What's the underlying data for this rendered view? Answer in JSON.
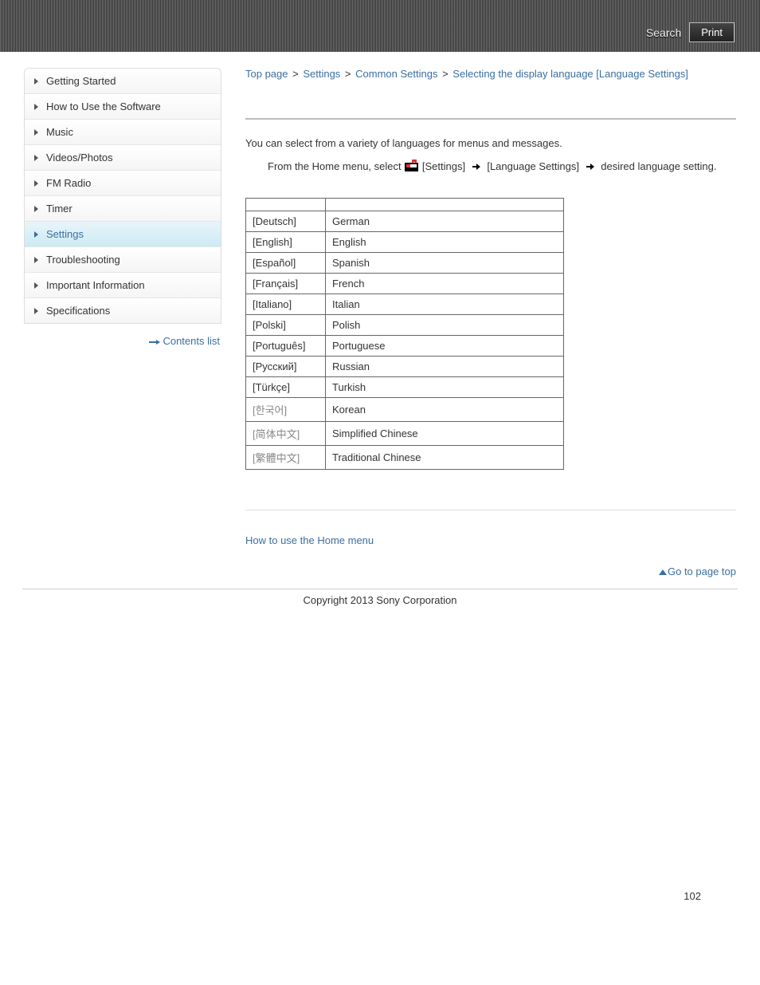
{
  "header": {
    "search_label": "Search",
    "print_label": "Print"
  },
  "sidebar": {
    "items": [
      {
        "label": "Getting Started",
        "active": false
      },
      {
        "label": "How to Use the Software",
        "active": false
      },
      {
        "label": "Music",
        "active": false
      },
      {
        "label": "Videos/Photos",
        "active": false
      },
      {
        "label": "FM Radio",
        "active": false
      },
      {
        "label": "Timer",
        "active": false
      },
      {
        "label": "Settings",
        "active": true
      },
      {
        "label": "Troubleshooting",
        "active": false
      },
      {
        "label": "Important Information",
        "active": false
      },
      {
        "label": "Specifications",
        "active": false
      }
    ],
    "contents_list_label": "Contents list"
  },
  "breadcrumb": {
    "items": [
      "Top page",
      "Settings",
      "Common Settings"
    ],
    "sep": ">",
    "current": "Selecting the display language [Language Settings]"
  },
  "content": {
    "intro": "You can select from a variety of languages for menus and messages.",
    "instruction_prefix": "From the Home menu, select",
    "instruction_step1": "[Settings]",
    "instruction_step2": "[Language Settings]",
    "instruction_step3": "desired language setting.",
    "table": {
      "rows": [
        {
          "k": "[Deutsch]",
          "v": "German"
        },
        {
          "k": "[English]",
          "v": "English"
        },
        {
          "k": "[Español]",
          "v": "Spanish"
        },
        {
          "k": "[Français]",
          "v": "French"
        },
        {
          "k": "[Italiano]",
          "v": "Italian"
        },
        {
          "k": "[Polski]",
          "v": "Polish"
        },
        {
          "k": "[Português]",
          "v": "Portuguese"
        },
        {
          "k": "[Русский]",
          "v": "Russian"
        },
        {
          "k": "[Türkçe]",
          "v": "Turkish"
        },
        {
          "k": "[한국어]",
          "v": "Korean",
          "gray": true
        },
        {
          "k": "[简体中文]",
          "v": "Simplified Chinese",
          "gray": true
        },
        {
          "k": "[繁體中文]",
          "v": "Traditional Chinese",
          "gray": true
        }
      ]
    },
    "related_link": "How to use the Home menu",
    "page_top_label": "Go to page top"
  },
  "footer": {
    "copyright": "Copyright 2013 Sony Corporation",
    "page_num": "102"
  }
}
